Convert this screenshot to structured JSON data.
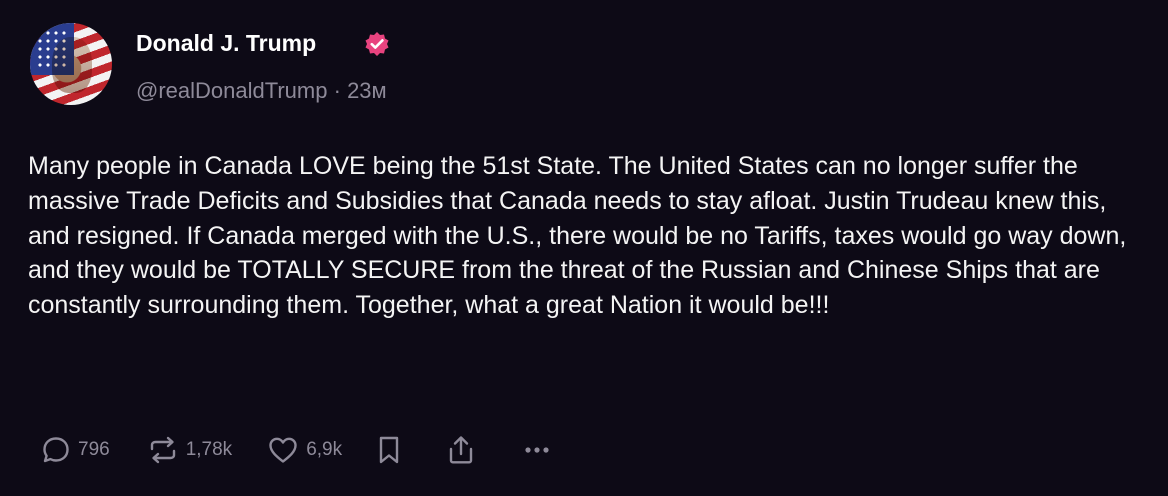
{
  "author": {
    "display_name": "Donald J. Trump",
    "handle": "@realDonaldTrump",
    "separator": "·",
    "time_ago": "23м",
    "verified_color": "#e8437f",
    "avatar_icon": "flag-portrait-avatar"
  },
  "post": {
    "text": "Many people in Canada LOVE being the 51st State. The United States can no longer suffer the massive Trade Deficits and Subsidies that Canada needs to stay afloat. Justin Trudeau knew this, and resigned. If Canada merged with the U.S., there would be no Tariffs, taxes would go way down, and they would be TOTALLY SECURE from the threat of the Russian and Chinese Ships that are constantly surrounding them. Together, what a great Nation it would be!!!"
  },
  "actions": {
    "reply_count": "796",
    "repost_count": "1,78k",
    "like_count": "6,9k",
    "icons": [
      "reply-icon",
      "repost-icon",
      "heart-icon",
      "bookmark-icon",
      "share-icon",
      "more-icon"
    ]
  },
  "colors": {
    "background": "#0d0a16",
    "text": "#f4f4f4",
    "muted": "#8e8a99"
  }
}
